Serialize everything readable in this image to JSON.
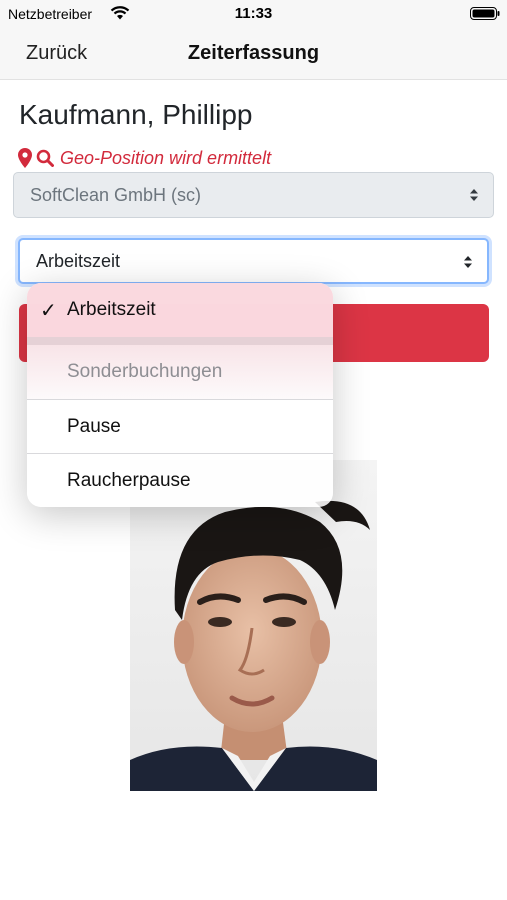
{
  "status_bar": {
    "carrier": "Netzbetreiber",
    "time": "11:33",
    "wifi_icon": "wifi-icon",
    "battery_icon": "battery-icon"
  },
  "nav": {
    "back_label": "Zurück",
    "title": "Zeiterfassung"
  },
  "user": {
    "name": "Kaufmann, Phillipp"
  },
  "geo": {
    "status_text": "Geo-Position wird ermittelt",
    "color": "#d22a3c"
  },
  "company_select": {
    "value": "SoftClean GmbH (sc)"
  },
  "type_select": {
    "value": "Arbeitszeit"
  },
  "colors": {
    "accent_red": "#dc3545",
    "focus_blue": "#86b7fe"
  },
  "dropdown": {
    "items": [
      {
        "label": "Arbeitszeit",
        "selected": true
      },
      {
        "label": "Sonderbuchungen",
        "header": true
      },
      {
        "label": "Pause"
      },
      {
        "label": "Raucherpause"
      }
    ]
  }
}
